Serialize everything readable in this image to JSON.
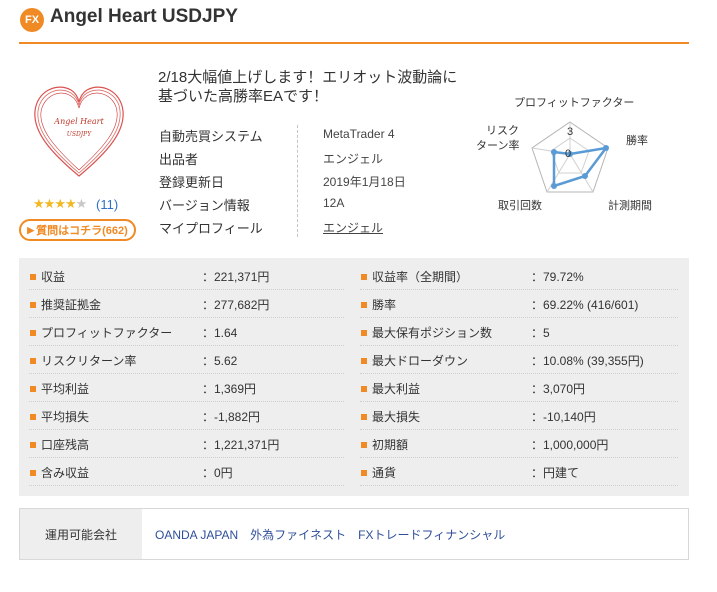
{
  "header": {
    "badge": "FX",
    "title": "Angel Heart USDJPY"
  },
  "product": {
    "image_text_line1": "Angel Heart",
    "image_text_line2": "USDJPY",
    "rating_stars": 4,
    "rating_max": 5,
    "review_count": "(11)",
    "question_button": "質問はコチラ(662)"
  },
  "headline": "2/18大幅値上げします！エリオット波動論に基づいた高勝率EAです！",
  "info": [
    {
      "label": "自動売買システム",
      "value": "MetaTrader 4"
    },
    {
      "label": "出品者",
      "value": "エンジェル"
    },
    {
      "label": "登録更新日",
      "value": "2019年1月18日"
    },
    {
      "label": "バージョン情報",
      "value": "12A"
    },
    {
      "label": "マイプロフィール",
      "value": "エンジェル"
    }
  ],
  "radar": {
    "labels": {
      "top": "プロフィットファクター",
      "right": "勝率",
      "bottom_right": "計測期間",
      "bottom_left": "取引回数",
      "left_line1": "リスク",
      "left_line2": "ターン率"
    },
    "scale_labels": [
      "3",
      "0"
    ],
    "accent_color": "#5b9bd5"
  },
  "stats": {
    "left": [
      {
        "label": "収益",
        "value": "：221,371円"
      },
      {
        "label": "推奨証拠金",
        "value": "：277,682円"
      },
      {
        "label": "プロフィットファクター",
        "value": "：1.64"
      },
      {
        "label": "リスクリターン率",
        "value": "：5.62"
      },
      {
        "label": "平均利益",
        "value": "：1,369円"
      },
      {
        "label": "平均損失",
        "value": "：-1,882円"
      },
      {
        "label": "口座残高",
        "value": "：1,221,371円"
      },
      {
        "label": "含み収益",
        "value": "：0円"
      }
    ],
    "right": [
      {
        "label": "収益率（全期間）",
        "value": "：79.72%"
      },
      {
        "label": "勝率",
        "value": "：69.22% (416/601)"
      },
      {
        "label": "最大保有ポジション数",
        "value": "：5"
      },
      {
        "label": "最大ドローダウン",
        "value": "：10.08% (39,355円)"
      },
      {
        "label": "最大利益",
        "value": "：3,070円"
      },
      {
        "label": "最大損失",
        "value": "：-10,140円"
      },
      {
        "label": "初期額",
        "value": "：1,000,000円"
      },
      {
        "label": "通貨",
        "value": "：円建て"
      }
    ]
  },
  "brokers": {
    "label": "運用可能会社",
    "list": "OANDA JAPAN　外為ファイネスト　FXトレードフィナンシャル"
  },
  "colors": {
    "accent": "#f08a24",
    "link": "#2f6fc4",
    "star": "#f2b821"
  }
}
